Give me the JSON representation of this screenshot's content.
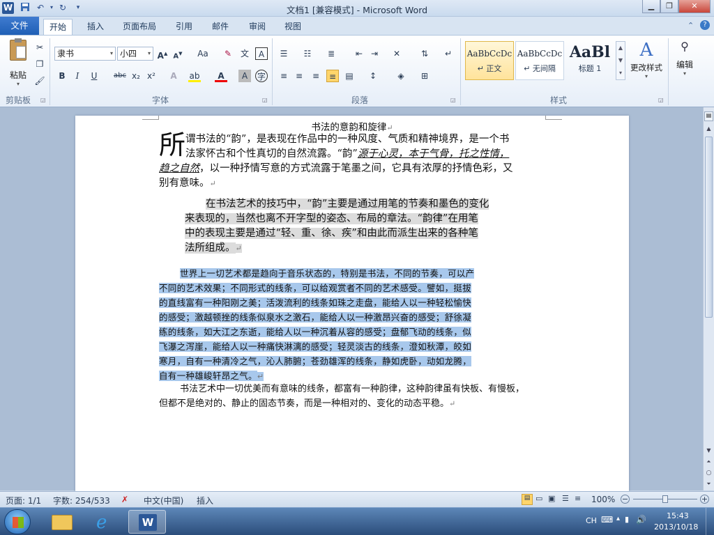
{
  "window": {
    "title": "文档1 [兼容模式] - Microsoft Word",
    "word_icon_label": "W"
  },
  "quick_access": {
    "save_icon": "save-icon",
    "undo_icon": "undo-icon",
    "redo_icon": "redo-icon",
    "customize_icon": "chevron-down-icon"
  },
  "tabs": {
    "file": "文件",
    "items": [
      "开始",
      "插入",
      "页面布局",
      "引用",
      "邮件",
      "审阅",
      "视图"
    ],
    "active": "开始"
  },
  "ribbon": {
    "clipboard": {
      "paste": "粘贴",
      "label": "剪贴板"
    },
    "font": {
      "name": "隶书",
      "size": "小四",
      "grow": "A",
      "shrink": "A",
      "case": "Aa",
      "bold": "B",
      "italic": "I",
      "underline": "U",
      "strike": "abc",
      "subscript": "x₂",
      "superscript": "x²",
      "label": "字体"
    },
    "paragraph": {
      "label": "段落"
    },
    "styles": {
      "items": [
        {
          "sample": "AaBbCcDc",
          "name": "↵ 正文"
        },
        {
          "sample": "AaBbCcDc",
          "name": "↵ 无间隔"
        },
        {
          "sample": "AaBl",
          "name": "标题 1"
        }
      ],
      "change": "更改样式",
      "label": "样式"
    },
    "editing": {
      "label": "编辑"
    }
  },
  "document": {
    "title": "书法的意韵和旋律",
    "para1": {
      "dropcap": "所",
      "line1": "谓书法的“韵”，是表现在作品中的一种风度、气质和精神境界，是一个书",
      "line2a": "法家怀古和个性真切的自然流露。“韵”",
      "line2b": "源于心灵，本于气骨，托之性情，",
      "line3a": "趋之自然",
      "line3b": "，以一种抒情写意的方式流露于笔墨之间，它具有浓厚的抒情色彩，又",
      "line4": "别有意味。"
    },
    "para2": [
      "在书法艺术的技巧中，“韵”主要是通过用笔的节奏和墨色的变化",
      "来表现的，当然也离不开字型的姿态、布局的章法。“韵律”在用笔",
      "中的表现主要是通过“轻、重、徐、疾”和由此而派生出来的各种笔",
      "法所组成。"
    ],
    "para3": [
      "世界上一切艺术都是趋向于音乐状态的，特别是书法，不同的节奏，可以产",
      "不同的艺术效果；不同形式的线条，可以给观赏者不同的艺术感受。譬如，挺拔",
      "的直线富有一种阳刚之美；活泼流利的线条如珠之走盘，能给人以一种轻松愉快",
      "的感受；激越顿挫的线条似泉水之激石，能给人以一种激昂兴奋的感受；舒徐凝",
      "练的线条，如大江之东逝，能给人以一种沉着从容的感受；盘郁飞动的线条，似",
      "飞瀑之泻崖，能给人以一种痛快淋漓的感受；轻灵淡古的线条，澄如秋潭，皎如",
      "寒月，自有一种清冷之气，沁人肺腑；苍劲雄浑的线条，静如虎卧，动如龙腾，",
      "自有一种雄峻轩昂之气。"
    ],
    "para4": [
      "书法艺术中一切优美而有意味的线条，都富有一种韵律，这种韵律虽有快板、有慢板，",
      "但都不是绝对的、静止的固态节奏，而是一种相对的、变化的动态平稳。"
    ],
    "para_mark": "↵"
  },
  "statusbar": {
    "page": "页面: 1/1",
    "words": "字数: 254/533",
    "language": "中文(中国)",
    "mode": "插入",
    "zoom": "100%"
  },
  "taskbar": {
    "ime": "CH",
    "time": "15:43",
    "date": "2013/10/18"
  }
}
